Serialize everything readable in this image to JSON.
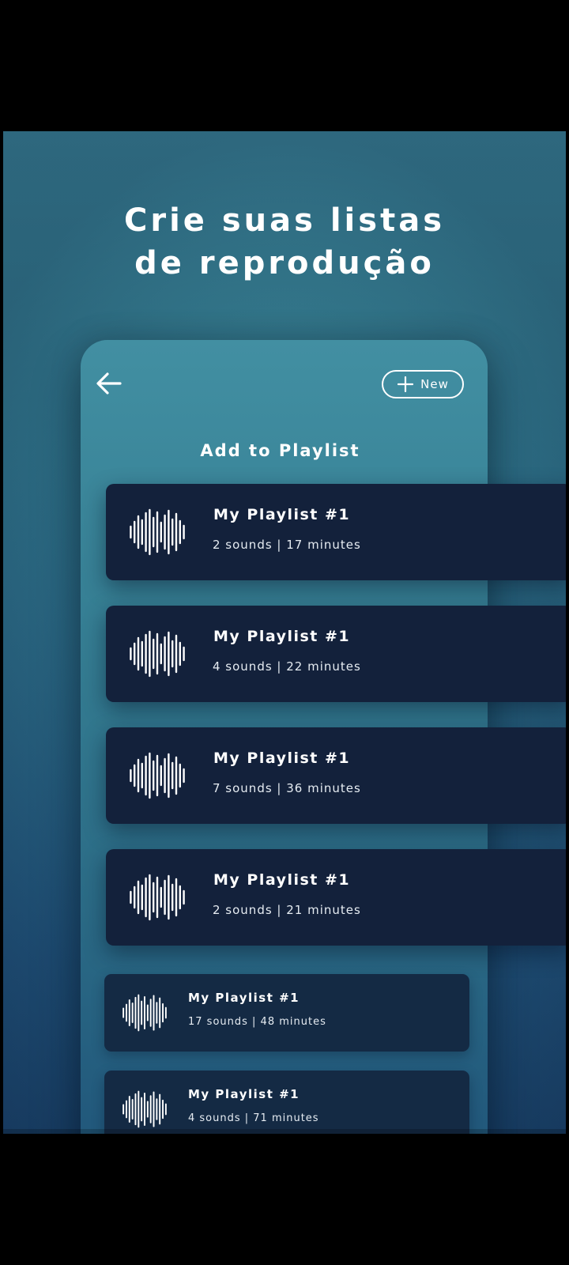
{
  "headline": {
    "line1": "Crie suas listas",
    "line2": "de reprodução"
  },
  "phone": {
    "back_icon": "arrow-left-icon",
    "new_button": {
      "icon": "plus-icon",
      "label": "New"
    },
    "title": "Add to Playlist"
  },
  "playlists": [
    {
      "name": "My Playlist #1",
      "meta": "2 sounds | 17 minutes"
    },
    {
      "name": "My Playlist #1",
      "meta": "4 sounds | 22 minutes"
    },
    {
      "name": "My Playlist #1",
      "meta": "7 sounds | 36 minutes"
    },
    {
      "name": "My Playlist #1",
      "meta": "2 sounds | 21 minutes"
    },
    {
      "name": "My Playlist #1",
      "meta": "17 sounds | 48 minutes"
    },
    {
      "name": "My Playlist #1",
      "meta": "4 sounds | 71 minutes"
    }
  ],
  "colors": {
    "card_bg": "#13213b",
    "accent_text": "#ffffff",
    "background_top": "#418fa1",
    "background_bottom": "#1d4870"
  }
}
